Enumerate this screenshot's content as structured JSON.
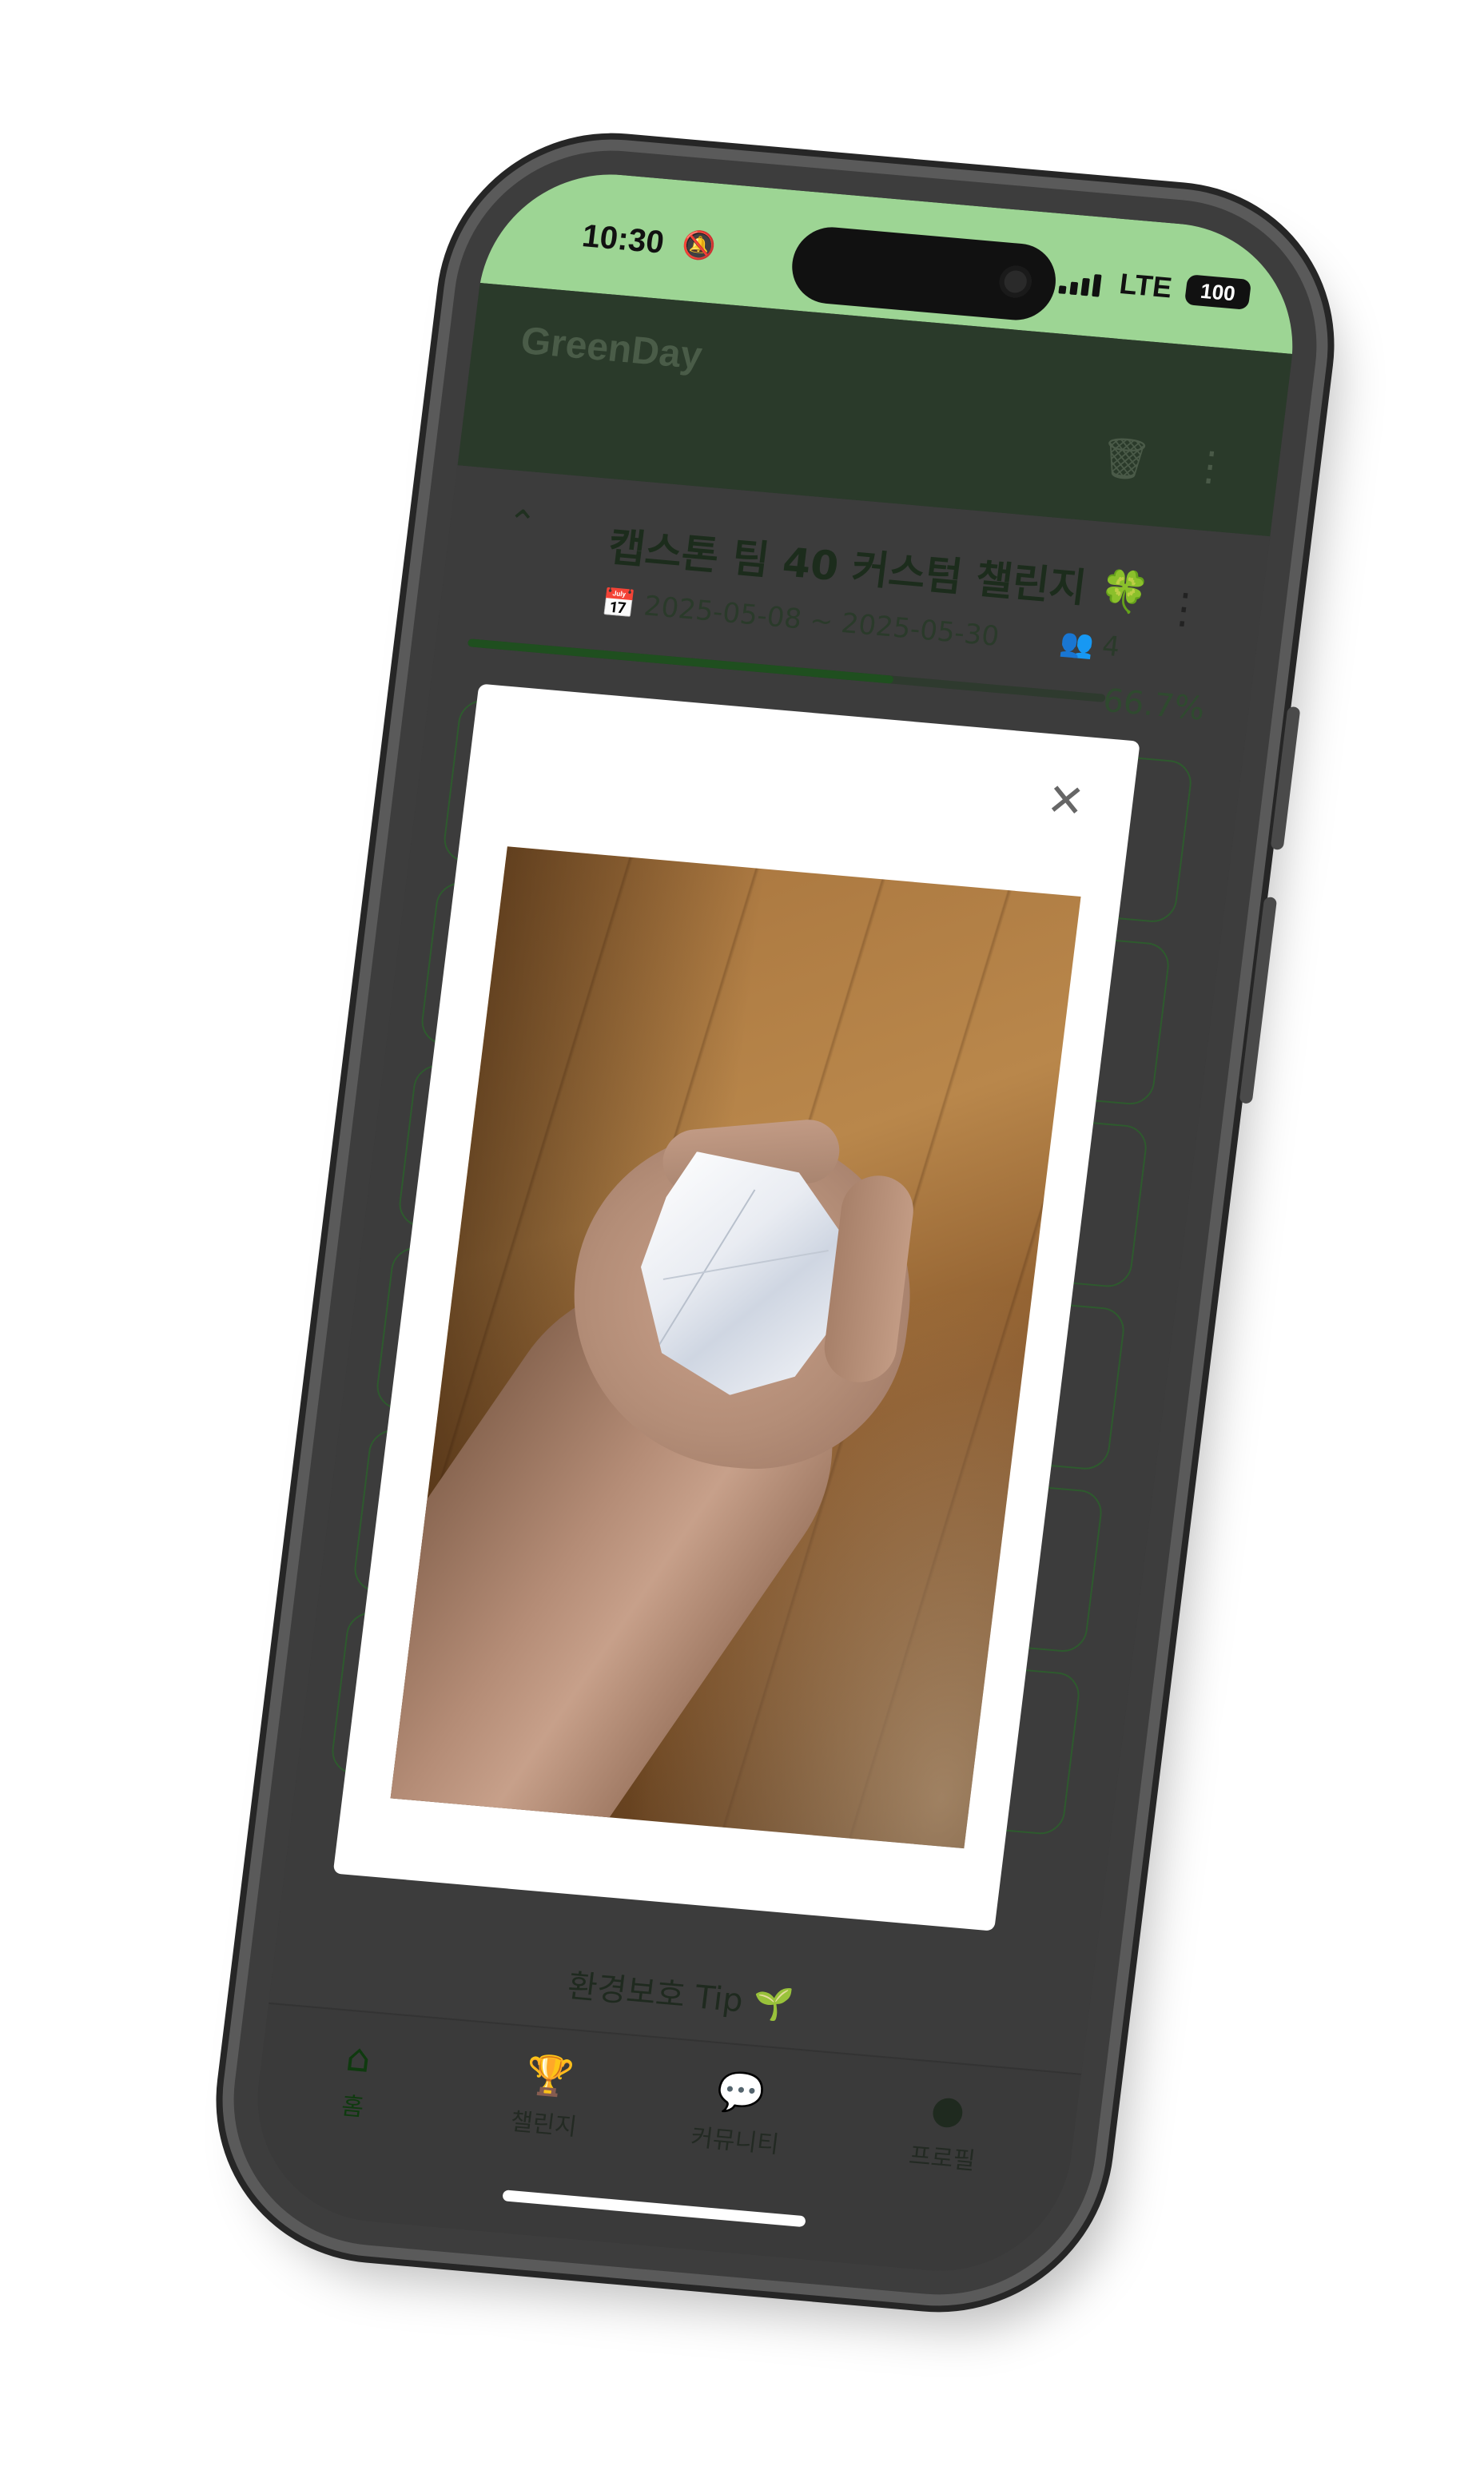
{
  "status_bar": {
    "time": "10:30",
    "bell_icon": "bell-slash-icon",
    "network": "LTE",
    "battery": "100"
  },
  "app_bar": {
    "title": "GreenDay",
    "actions": [
      "delete-list-icon",
      "more-vert-icon"
    ]
  },
  "challenge": {
    "collapse_icon": "chevron-up-icon",
    "title": "캡스톤 팀 40 커스텀 챌린지 🍀",
    "date_range": "2025-05-08 ~ 2025-05-30",
    "members": "4",
    "progress_label": "66.7%",
    "progress_value": 0.667
  },
  "tip": {
    "label": "환경보호 Tip 🌱"
  },
  "bottom_nav": [
    {
      "label": "홈",
      "icon": "home-icon",
      "active": true
    },
    {
      "label": "챌린지",
      "icon": "trophy-icon",
      "active": false
    },
    {
      "label": "커뮤니티",
      "icon": "forum-icon",
      "active": false
    },
    {
      "label": "프로필",
      "icon": "account-circle-icon",
      "active": false
    }
  ],
  "modal": {
    "close_icon": "close-icon",
    "photo_subject": "hand-holding-crumpled-paper"
  },
  "colors": {
    "status_bar": "#9dd594",
    "app_bar": "#2a3a2a",
    "overlay": "#3c3c3c",
    "accent": "#1f4f1f"
  }
}
